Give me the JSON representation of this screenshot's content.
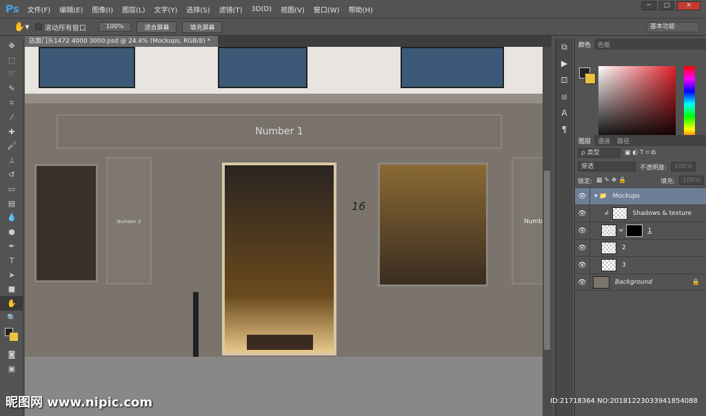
{
  "app": {
    "logo": "Ps"
  },
  "menu": [
    "文件(F)",
    "编辑(E)",
    "图像(I)",
    "图层(L)",
    "文字(Y)",
    "选择(S)",
    "滤镜(T)",
    "3D(D)",
    "视图(V)",
    "窗口(W)",
    "帮助(H)"
  ],
  "window_controls": [
    "─",
    "□",
    "✕"
  ],
  "options": {
    "scroll_all_label": "滚动所有窗口",
    "zoom_100": "100%",
    "fit_screen": "适合屏幕",
    "fill_screen": "填充屏幕",
    "workspace": "基本功能"
  },
  "document": {
    "tab_title": "店面门头1472 4000 3000.psd @ 24.4% (Mockups, RGB/8) *",
    "close": "×"
  },
  "canvas_text": {
    "sign_main": "Number 1",
    "sign_left": "Number 2",
    "sign_right": "Numb",
    "house_number": "16"
  },
  "color_panel": {
    "tabs": [
      "颜色",
      "色板"
    ],
    "foreground": "#222222",
    "background": "#e8c43c"
  },
  "layers_panel": {
    "tabs": [
      "图层",
      "通道",
      "路径"
    ],
    "filter": "ρ 类型",
    "blend_mode": "穿透",
    "opacity_label": "不透明度:",
    "opacity": "100%",
    "lock_label": "锁定:",
    "fill_label": "填充:",
    "fill": "100%",
    "layers": [
      {
        "name": "Mockups",
        "type": "group",
        "selected": true
      },
      {
        "name": "Shadows & texture",
        "type": "clipped"
      },
      {
        "name": "1",
        "type": "smart-masked"
      },
      {
        "name": "2",
        "type": "smart"
      },
      {
        "name": "3",
        "type": "smart"
      },
      {
        "name": "Background",
        "type": "background",
        "locked": true
      }
    ]
  },
  "watermark": "昵图网 www.nipic.com",
  "image_id": "ID:21718364 NO:20181223033941854088"
}
